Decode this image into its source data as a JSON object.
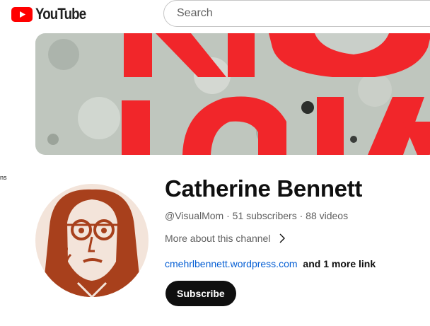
{
  "header": {
    "logo_text": "YouTube",
    "search_placeholder": "Search"
  },
  "sidebar": {
    "cut_text": "ns"
  },
  "banner": {
    "image": "red-stencil-letters-on-weathered-wall"
  },
  "channel": {
    "name": "Catherine Bennett",
    "handle": "@VisualMom",
    "subscribers": "51 subscribers",
    "videos": "88 videos",
    "about_label": "More about this channel",
    "link_primary": "cmehrlbennett.wordpress.com",
    "link_more": "and 1 more link",
    "subscribe_label": "Subscribe"
  },
  "colors": {
    "brand_red": "#ff0000",
    "link_blue": "#065fd4",
    "text_secondary": "#606060",
    "button_dark": "#0f0f0f",
    "avatar_tone": "#a8401c"
  }
}
